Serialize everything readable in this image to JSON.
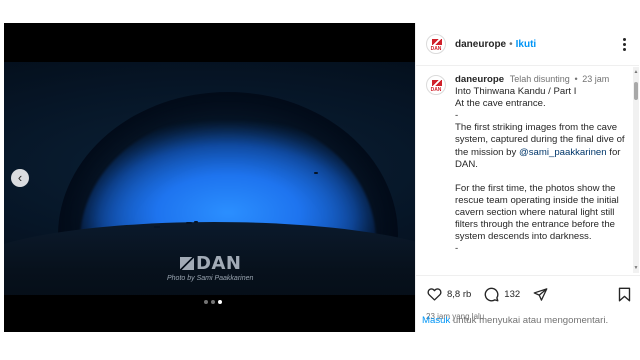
{
  "media": {
    "watermark": "DAN",
    "credit": "Photo by Sami Paakkarinen",
    "dots": {
      "count": 3,
      "active_index": 2
    },
    "prev_icon": "chevron-left-icon"
  },
  "header": {
    "avatar_text": "DAN",
    "username": "daneurope",
    "separator": "•",
    "follow_label": "Ikuti",
    "more_icon": "more-vertical-icon"
  },
  "caption": {
    "avatar_text": "DAN",
    "username": "daneurope",
    "edited": "Telah disunting",
    "separator": "•",
    "time": "23 jam",
    "line1": "Into Thinwana Kandu / Part I",
    "line2": "At the cave entrance.",
    "line3": "-",
    "para1_before": "The first striking images from the cave system, captured during the final dive of the mission by ",
    "mention": "@sami_paakkarinen",
    "para1_after": " for DAN.",
    "para2": "For the first time, the photos show the rescue team operating inside the initial cavern section where natural light still filters through the entrance before the system descends into darkness.",
    "trail": "-"
  },
  "actions": {
    "like_count": "8,8 rb",
    "comment_count": "132",
    "posted": "23 jam yang lalu",
    "icons": [
      "heart-icon",
      "comment-icon",
      "share-icon",
      "bookmark-icon"
    ]
  },
  "login": {
    "link": "Masuk",
    "text": " untuk menyukai atau mengomentari."
  },
  "colors": {
    "accent": "#0095f6",
    "brand": "#d0202a",
    "text": "#262626",
    "muted": "#737373"
  }
}
